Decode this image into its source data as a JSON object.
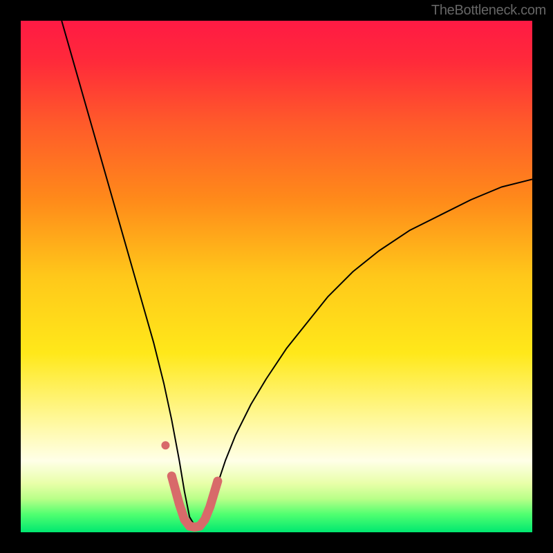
{
  "attribution": "TheBottleneck.com",
  "chart_data": {
    "type": "line",
    "title": "",
    "xlabel": "",
    "ylabel": "",
    "xlim": [
      0,
      100
    ],
    "ylim": [
      0,
      100
    ],
    "background_gradient": {
      "stops": [
        {
          "offset": 0.0,
          "color": "#ff1a44"
        },
        {
          "offset": 0.08,
          "color": "#ff2a3a"
        },
        {
          "offset": 0.2,
          "color": "#ff5a2a"
        },
        {
          "offset": 0.35,
          "color": "#ff8a1a"
        },
        {
          "offset": 0.5,
          "color": "#ffc81a"
        },
        {
          "offset": 0.65,
          "color": "#ffe81a"
        },
        {
          "offset": 0.78,
          "color": "#fff89a"
        },
        {
          "offset": 0.86,
          "color": "#ffffe8"
        },
        {
          "offset": 0.905,
          "color": "#e8ffa8"
        },
        {
          "offset": 0.935,
          "color": "#b8ff88"
        },
        {
          "offset": 0.965,
          "color": "#50ff70"
        },
        {
          "offset": 1.0,
          "color": "#00e870"
        }
      ]
    },
    "series": [
      {
        "name": "bottleneck-curve",
        "color": "#000000",
        "width": 2,
        "x": [
          8,
          10,
          12,
          14,
          16,
          18,
          20,
          22,
          24,
          26,
          28,
          29.5,
          31,
          32,
          33,
          34.5,
          36,
          38,
          40,
          42,
          45,
          48,
          52,
          56,
          60,
          65,
          70,
          76,
          82,
          88,
          94,
          100
        ],
        "y": [
          100,
          93,
          86,
          79,
          72,
          65,
          58,
          51,
          44,
          37,
          29,
          22,
          14,
          8,
          3,
          0.5,
          3,
          8,
          14,
          19,
          25,
          30,
          36,
          41,
          46,
          51,
          55,
          59,
          62,
          65,
          67.5,
          69
        ]
      },
      {
        "name": "highlight-band",
        "color": "#d86a6a",
        "width": 13,
        "linecap": "round",
        "x": [
          29.5,
          31,
          32,
          33,
          34,
          35,
          36,
          37,
          38.5
        ],
        "y": [
          11,
          5.5,
          2.5,
          1.2,
          1.0,
          1.2,
          2.5,
          5.0,
          10
        ]
      }
    ],
    "markers": [
      {
        "name": "highlight-dot",
        "x": 28.3,
        "y": 17,
        "r": 6,
        "color": "#d86a6a"
      }
    ]
  }
}
